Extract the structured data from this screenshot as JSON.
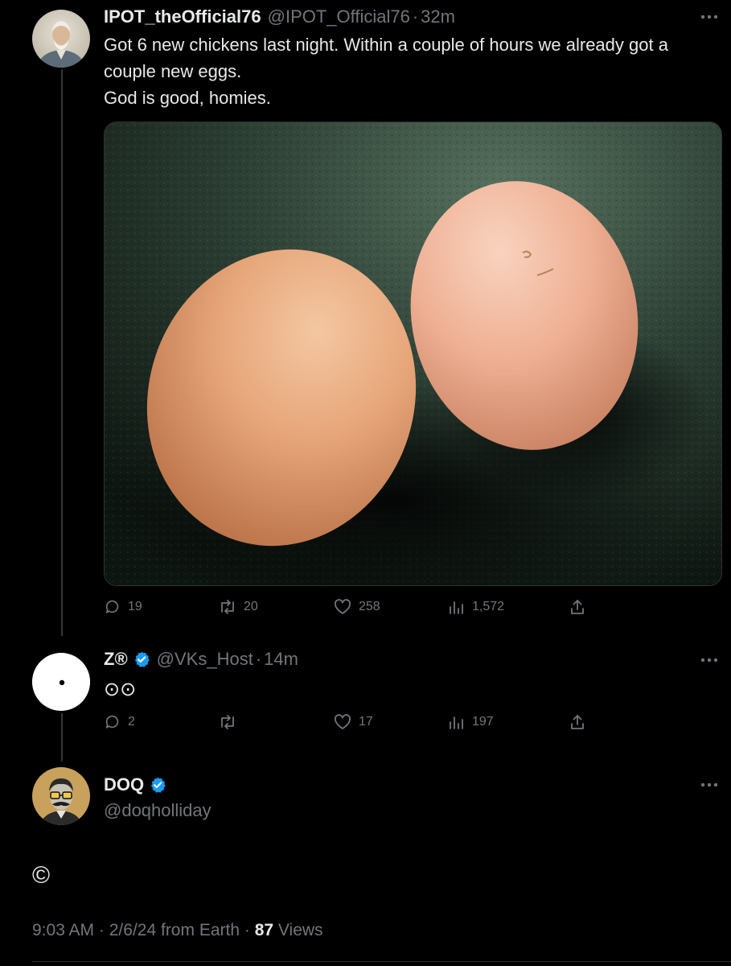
{
  "tweets": [
    {
      "display_name": "IPOT_theOfficial76",
      "handle": "@IPOT_Official76",
      "separator": "·",
      "time": "32m",
      "text_lines": [
        "Got 6 new chickens last night. Within a couple of hours we already got a",
        "couple new eggs.",
        "God is good, homies."
      ],
      "media_icon": "photo-two-brown-eggs",
      "actions": {
        "replies": "19",
        "reposts": "20",
        "likes": "258",
        "views": "1,572"
      }
    },
    {
      "display_name": "Z®",
      "handle": "@VKs_Host",
      "separator": "·",
      "time": "14m",
      "verified": true,
      "text": "⊙⊙",
      "actions": {
        "replies": "2",
        "reposts": "",
        "likes": "17",
        "views": "197"
      }
    }
  ],
  "main_tweet": {
    "display_name": "DOQ",
    "handle": "@doqholliday",
    "verified": true,
    "text": "©",
    "meta": {
      "time": "9:03 AM",
      "separator": "·",
      "date": "2/6/24",
      "source": "from Earth",
      "views_count": "87",
      "views_label": "Views"
    }
  },
  "colors": {
    "background": "#000000",
    "text_primary": "#e7e9ea",
    "text_secondary": "#71767b",
    "verified_blue": "#1d9bf0",
    "thread_line": "#333639"
  }
}
